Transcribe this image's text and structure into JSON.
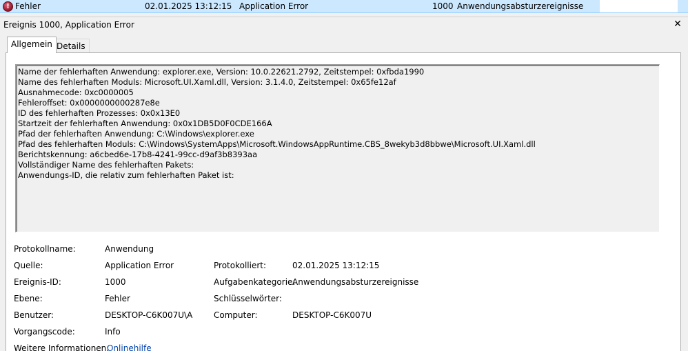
{
  "event_row": {
    "level": "Fehler",
    "datetime": "02.01.2025 13:12:15",
    "source": "Application Error",
    "event_id": "1000",
    "category": "Anwendungsabsturzereignisse",
    "icon": "error-icon"
  },
  "details": {
    "title": "Ereignis 1000, Application Error",
    "close_glyph": "✕",
    "tabs": [
      {
        "label": "Allgemein",
        "active": true
      },
      {
        "label": "Details",
        "active": false
      }
    ],
    "description_lines": [
      "Name der fehlerhaften Anwendung: explorer.exe, Version: 10.0.22621.2792, Zeitstempel: 0xfbda1990",
      "Name des fehlerhaften Moduls: Microsoft.UI.Xaml.dll, Version: 3.1.4.0, Zeitstempel: 0x65fe12af",
      "Ausnahmecode: 0xc0000005",
      "Fehleroffset: 0x0000000000287e8e",
      "ID des fehlerhaften Prozesses: 0x0x13E0",
      "Startzeit der fehlerhaften Anwendung: 0x0x1DB5D0F0CDE166A",
      "Pfad der fehlerhaften Anwendung: C:\\Windows\\explorer.exe",
      "Pfad des fehlerhaften Moduls: C:\\Windows\\SystemApps\\Microsoft.WindowsAppRuntime.CBS_8wekyb3d8bbwe\\Microsoft.UI.Xaml.dll",
      "Berichtskennung: a6cbed6e-17b8-4241-99cc-d9af3b8393aa",
      "Vollständiger Name des fehlerhaften Pakets:",
      "Anwendungs-ID, die relativ zum fehlerhaften Paket ist:"
    ],
    "properties": {
      "protokollname_label": "Protokollname:",
      "protokollname_value": "Anwendung",
      "quelle_label": "Quelle:",
      "quelle_value": "Application Error",
      "protokolliert_label": "Protokolliert:",
      "protokolliert_value": "02.01.2025 13:12:15",
      "ereignis_id_label": "Ereignis-ID:",
      "ereignis_id_value": "1000",
      "aufgabenkategorie_label": "Aufgabenkategorie:",
      "aufgabenkategorie_value": "Anwendungsabsturzereignisse",
      "ebene_label": "Ebene:",
      "ebene_value": "Fehler",
      "schluesselwoerter_label": "Schlüsselwörter:",
      "schluesselwoerter_value": "",
      "benutzer_label": "Benutzer:",
      "benutzer_value": "DESKTOP-C6K007U\\A",
      "computer_label": "Computer:",
      "computer_value": "DESKTOP-C6K007U",
      "vorgangscode_label": "Vorgangscode:",
      "vorgangscode_value": "Info",
      "weitere_label": "Weitere Informationen:",
      "weitere_link": "Onlinehilfe"
    }
  }
}
